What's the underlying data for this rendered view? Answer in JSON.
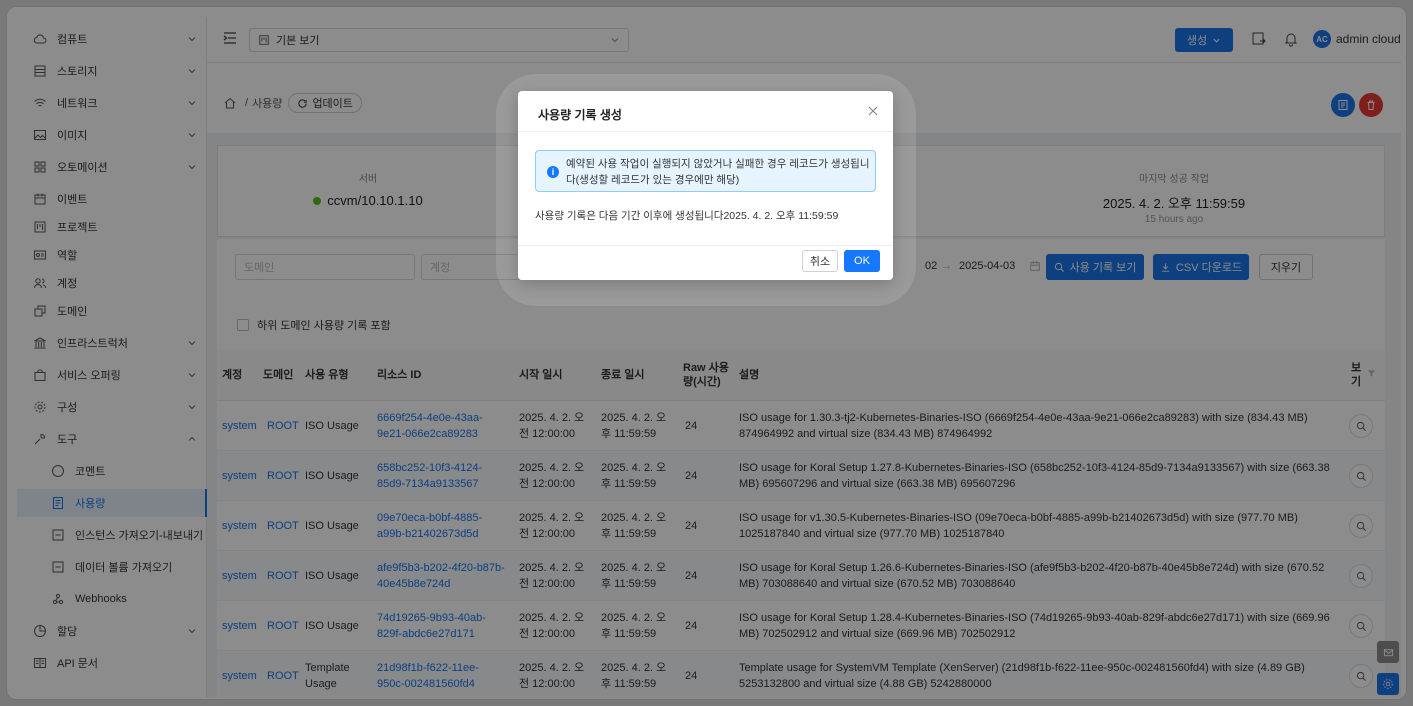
{
  "sidebar": {
    "items": [
      {
        "label": "컴퓨트",
        "icon": "cloud-icon",
        "chevron": "down"
      },
      {
        "label": "스토리지",
        "icon": "storage-icon",
        "chevron": "down"
      },
      {
        "label": "네트워크",
        "icon": "wifi-icon",
        "chevron": "down"
      },
      {
        "label": "이미지",
        "icon": "image-icon",
        "chevron": "down"
      },
      {
        "label": "오토메이션",
        "icon": "automation-icon",
        "chevron": "down"
      },
      {
        "label": "이벤트",
        "icon": "calendar-icon"
      },
      {
        "label": "프로젝트",
        "icon": "project-icon"
      },
      {
        "label": "역할",
        "icon": "role-icon"
      },
      {
        "label": "계정",
        "icon": "team-icon"
      },
      {
        "label": "도메인",
        "icon": "domain-icon"
      },
      {
        "label": "인프라스트럭처",
        "icon": "bank-icon",
        "chevron": "down"
      },
      {
        "label": "서비스 오퍼링",
        "icon": "shopping-icon",
        "chevron": "down"
      },
      {
        "label": "구성",
        "icon": "settings-icon",
        "chevron": "down"
      },
      {
        "label": "도구",
        "icon": "tool-icon",
        "chevron": "up"
      },
      {
        "label": "코멘트",
        "icon": "comment-icon"
      },
      {
        "label": "사용량",
        "icon": "usage-icon"
      },
      {
        "label": "인스턴스 가져오기-내보내기",
        "icon": "import-icon"
      },
      {
        "label": "데이터 볼륨 가져오기",
        "icon": "import-icon"
      },
      {
        "label": "Webhooks",
        "icon": "webhook-icon"
      },
      {
        "label": "할당",
        "icon": "pie-icon",
        "chevron": "down"
      },
      {
        "label": "API 문서",
        "icon": "doc-icon"
      }
    ]
  },
  "topbar": {
    "view_label": "기본 보기",
    "create_label": "생성",
    "avatar_initials": "AC",
    "username": "admin cloud"
  },
  "breadcrumb": {
    "separator": "/",
    "page": "사용량",
    "refresh_label": "업데이트"
  },
  "stats": {
    "server_label": "서버",
    "server_value": "ccvm/10.10.1.10",
    "last_job_label": "마지막 성공 작업",
    "last_job_value": "2025. 4. 2. 오후 11:59:59",
    "last_job_ago": "15 hours ago"
  },
  "filters": {
    "domain_placeholder": "도메인",
    "account_placeholder": "계정",
    "date_range_partial": "02",
    "date_arrow": "→",
    "end_date": "2025-04-03",
    "view_button": "사용 기록 보기",
    "csv_button": "CSV 다운로드",
    "clear_button": "지우기",
    "subdomain_checkbox": "하위 도메인 사용량 기록 포함"
  },
  "table": {
    "headers": [
      "계정",
      "도메인",
      "사용 유형",
      "리소스 ID",
      "시작 일시",
      "종료 일시",
      "Raw 사용량(시간)",
      "설명",
      "보기"
    ],
    "rows": [
      {
        "account": "system",
        "domain": "ROOT",
        "type": "ISO Usage",
        "resource": "6669f254-4e0e-43aa-9e21-066e2ca89283",
        "start": "2025. 4. 2. 오전 12:00:00",
        "end": "2025. 4. 2. 오후 11:59:59",
        "raw": "24",
        "desc": "ISO usage for 1.30.3-tj2-Kubernetes-Binaries-ISO (6669f254-4e0e-43aa-9e21-066e2ca89283) with size (834.43 MB) 874964992 and virtual size (834.43 MB) 874964992"
      },
      {
        "account": "system",
        "domain": "ROOT",
        "type": "ISO Usage",
        "resource": "658bc252-10f3-4124-85d9-7134a9133567",
        "start": "2025. 4. 2. 오전 12:00:00",
        "end": "2025. 4. 2. 오후 11:59:59",
        "raw": "24",
        "desc": "ISO usage for Koral Setup 1.27.8-Kubernetes-Binaries-ISO (658bc252-10f3-4124-85d9-7134a9133567) with size (663.38 MB) 695607296 and virtual size (663.38 MB) 695607296"
      },
      {
        "account": "system",
        "domain": "ROOT",
        "type": "ISO Usage",
        "resource": "09e70eca-b0bf-4885-a99b-b21402673d5d",
        "start": "2025. 4. 2. 오전 12:00:00",
        "end": "2025. 4. 2. 오후 11:59:59",
        "raw": "24",
        "desc": "ISO usage for v1.30.5-Kubernetes-Binaries-ISO (09e70eca-b0bf-4885-a99b-b21402673d5d) with size (977.70 MB) 1025187840 and virtual size (977.70 MB) 1025187840"
      },
      {
        "account": "system",
        "domain": "ROOT",
        "type": "ISO Usage",
        "resource": "afe9f5b3-b202-4f20-b87b-40e45b8e724d",
        "start": "2025. 4. 2. 오전 12:00:00",
        "end": "2025. 4. 2. 오후 11:59:59",
        "raw": "24",
        "desc": "ISO usage for Koral Setup 1.26.6-Kubernetes-Binaries-ISO (afe9f5b3-b202-4f20-b87b-40e45b8e724d) with size (670.52 MB) 703088640 and virtual size (670.52 MB) 703088640"
      },
      {
        "account": "system",
        "domain": "ROOT",
        "type": "ISO Usage",
        "resource": "74d19265-9b93-40ab-829f-abdc6e27d171",
        "start": "2025. 4. 2. 오전 12:00:00",
        "end": "2025. 4. 2. 오후 11:59:59",
        "raw": "24",
        "desc": "ISO usage for Koral Setup 1.28.4-Kubernetes-Binaries-ISO (74d19265-9b93-40ab-829f-abdc6e27d171) with size (669.96 MB) 702502912 and virtual size (669.96 MB) 702502912"
      },
      {
        "account": "system",
        "domain": "ROOT",
        "type": "Template Usage",
        "resource": "21d98f1b-f622-11ee-950c-002481560fd4",
        "start": "2025. 4. 2. 오전 12:00:00",
        "end": "2025. 4. 2. 오후 11:59:59",
        "raw": "24",
        "desc": "Template usage for SystemVM Template (XenServer) (21d98f1b-f622-11ee-950c-002481560fd4) with size (4.89 GB) 5253132800 and virtual size (4.88 GB) 5242880000"
      }
    ]
  },
  "modal": {
    "title": "사용량 기록 생성",
    "alert_text": "예약된 사용 작업이 실행되지 않았거나 실패한 경우 레코드가 생성됩니다(생성할 레코드가 있는 경우에만 해당)",
    "body_text": "사용량 기록은 다음 기간 이후에 생성됩니다2025. 4. 2. 오후 11:59:59",
    "cancel_label": "취소",
    "ok_label": "OK"
  },
  "colors": {
    "primary": "#1a73e8",
    "danger": "#e53935",
    "success": "#52c41a"
  }
}
